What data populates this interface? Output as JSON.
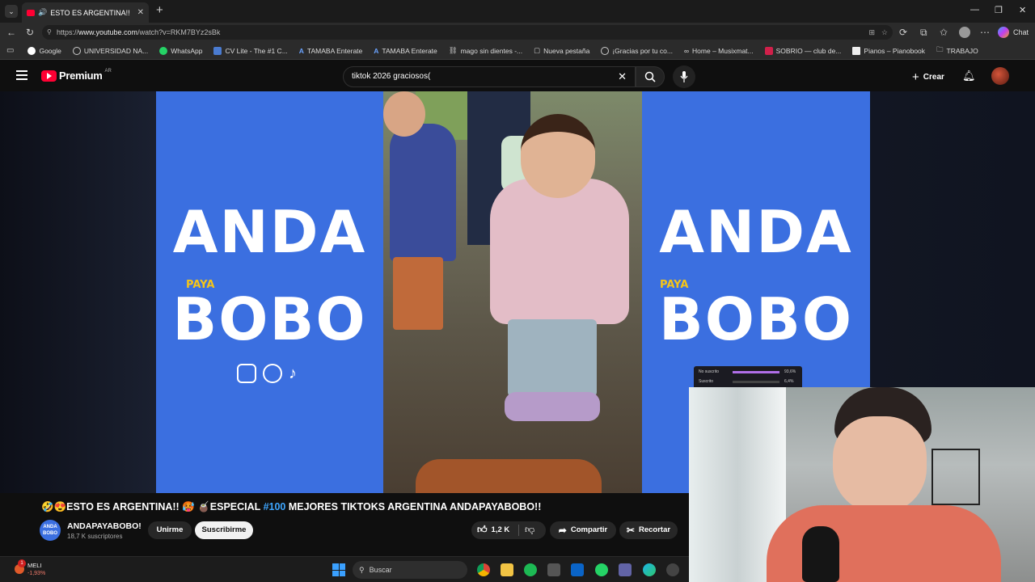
{
  "browser": {
    "tab_title": "ESTO ES ARGENTINA!!",
    "url_prefix": "https://",
    "url_domain": "www.youtube.com",
    "url_path": "/watch?v=RKM7BYz2sBk",
    "chat_label": "Chat",
    "bookmarks": [
      {
        "label": "Google",
        "icon": "google-icon"
      },
      {
        "label": "UNIVERSIDAD NA...",
        "icon": "globe-icon"
      },
      {
        "label": "WhatsApp",
        "icon": "whatsapp-icon"
      },
      {
        "label": "CV Lite - The #1 C...",
        "icon": "cv-icon"
      },
      {
        "label": "TAMABA Enterate",
        "icon": "tamaba-icon"
      },
      {
        "label": "TAMABA Enterate",
        "icon": "tamaba-icon"
      },
      {
        "label": "mago sin dientes -...",
        "icon": "link-icon"
      },
      {
        "label": "Nueva pestaña",
        "icon": "page-icon"
      },
      {
        "label": "¡Gracias por tu co...",
        "icon": "globe-icon"
      },
      {
        "label": "Home – Musixmat...",
        "icon": "musixmatch-icon"
      },
      {
        "label": "SOBRIO — club de...",
        "icon": "sobrio-icon"
      },
      {
        "label": "Pianos – Pianobook",
        "icon": "pianobook-icon"
      },
      {
        "label": "TRABAJO",
        "icon": "folder-icon"
      }
    ]
  },
  "youtube": {
    "logo_text": "Premium",
    "region": "AR",
    "search_value": "tiktok 2026 graciosos(",
    "create_label": "Crear"
  },
  "video": {
    "overlay_word1": "ANDA",
    "overlay_word2": "PAYA",
    "overlay_word3": "BOBO",
    "stats_rows": [
      {
        "label": "No suscrito",
        "value": "93,6%"
      },
      {
        "label": "Suscrito",
        "value": "6,4%"
      }
    ]
  },
  "details": {
    "title_prefix": "🤣😍ESTO ES ARGENTINA!! 🥵 🧉ESPECIAL ",
    "title_hashtag": "#100",
    "title_suffix": " MEJORES TIKTOKS ARGENTINA ANDAPAYABOBO!!",
    "channel_avatar_text": "ANDA BOBO",
    "channel_name": "ANDAPAYABOBO!",
    "subscribers": "18,7 K suscriptores",
    "join_label": "Unirme",
    "subscribe_label": "Suscribirme",
    "likes": "1,2 K",
    "share_label": "Compartir",
    "clip_label": "Recortar"
  },
  "taskbar": {
    "stock_name": "MELI",
    "stock_change": "-1,93%",
    "stock_badge": "1",
    "search_label": "Buscar"
  },
  "colors": {
    "brand_red": "#ff0033",
    "panel_blue": "#3b6fe0",
    "link_blue": "#3ea6ff"
  }
}
